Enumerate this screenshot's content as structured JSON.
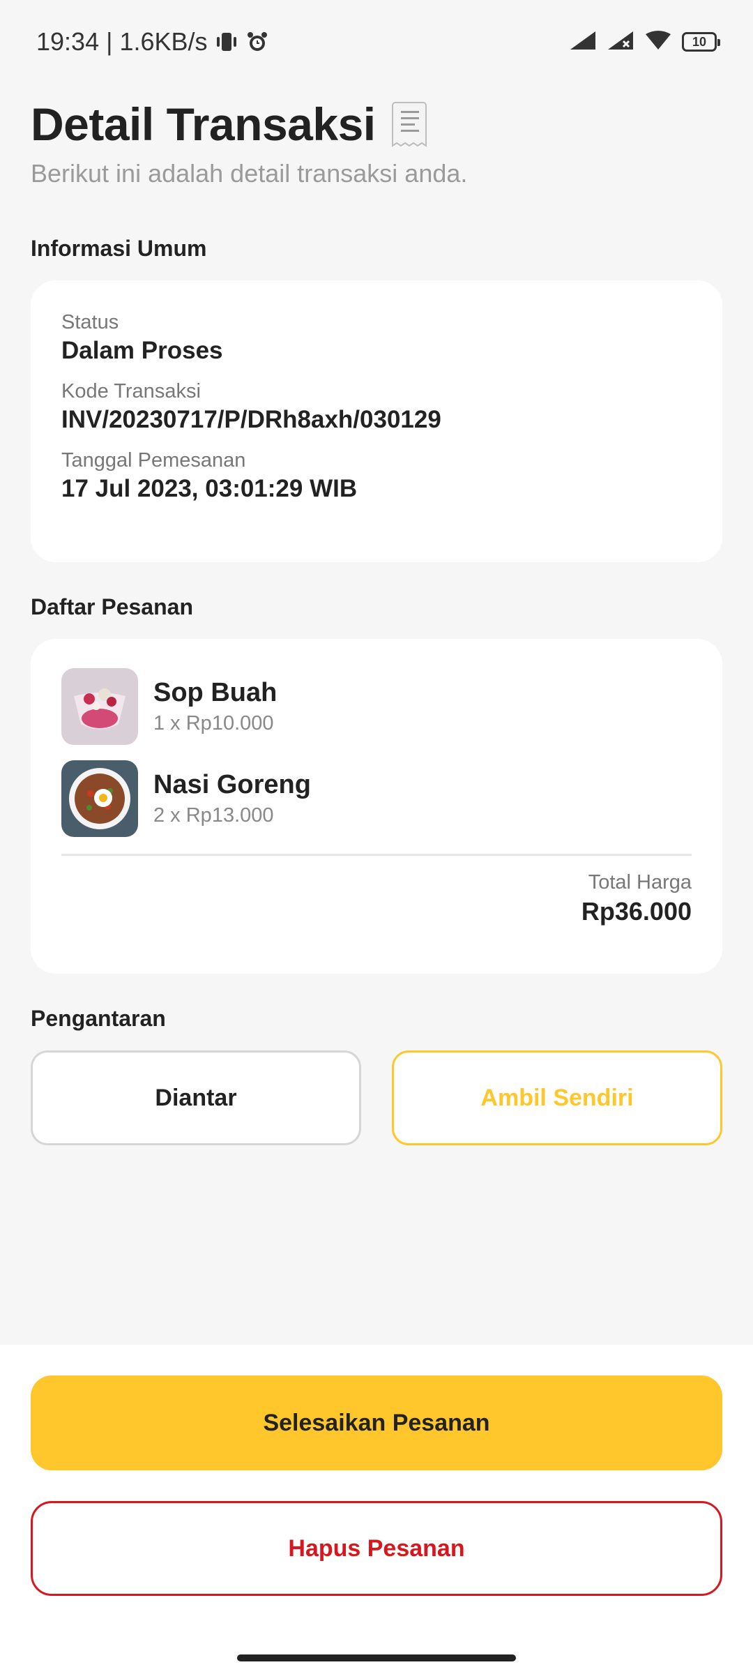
{
  "status_bar": {
    "time_speed": "19:34 | 1.6KB/s",
    "battery": "10",
    "icons": [
      "vibrate-icon",
      "alarm-icon",
      "signal-icon",
      "signal-x-icon",
      "wifi-icon",
      "battery-icon"
    ]
  },
  "header": {
    "title": "Detail Transaksi",
    "subtitle": "Berikut ini adalah detail transaksi anda.",
    "icon": "receipt-icon"
  },
  "general_info": {
    "section_label": "Informasi Umum",
    "status_label": "Status",
    "status_value": "Dalam Proses",
    "code_label": "Kode Transaksi",
    "code_value": "INV/20230717/P/DRh8axh/030129",
    "date_label": "Tanggal Pemesanan",
    "date_value": "17 Jul 2023, 03:01:29 WIB"
  },
  "orders": {
    "section_label": "Daftar Pesanan",
    "items": [
      {
        "name": "Sop Buah",
        "qty_price": "1 x Rp10.000"
      },
      {
        "name": "Nasi Goreng",
        "qty_price": "2 x Rp13.000"
      }
    ],
    "total_label": "Total Harga",
    "total_value": "Rp36.000"
  },
  "delivery": {
    "section_label": "Pengantaran",
    "option_deliver": "Diantar",
    "option_pickup": "Ambil Sendiri",
    "selected": "Ambil Sendiri"
  },
  "actions": {
    "finish_label": "Selesaikan Pesanan",
    "delete_label": "Hapus Pesanan"
  },
  "colors": {
    "accent": "#ffc72c",
    "danger": "#d7161e",
    "background": "#f6f6f6",
    "card": "#ffffff"
  }
}
